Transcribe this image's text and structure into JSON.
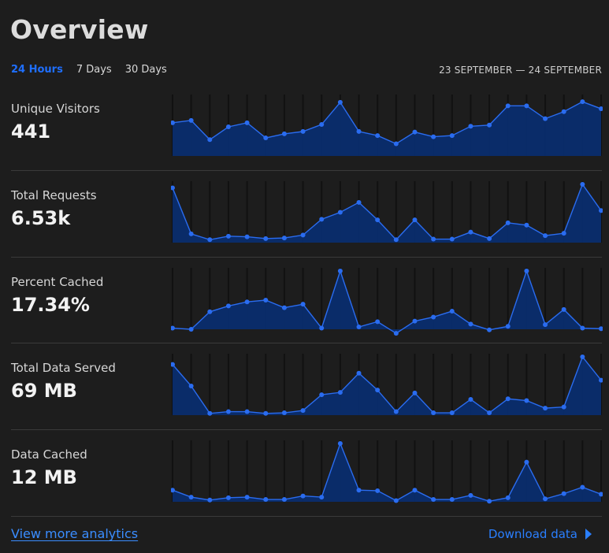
{
  "header": {
    "title": "Overview",
    "tabs": [
      {
        "label": "24 Hours",
        "active": true
      },
      {
        "label": "7 Days",
        "active": false
      },
      {
        "label": "30 Days",
        "active": false
      }
    ],
    "date_range": "23 SEPTEMBER — 24 SEPTEMBER"
  },
  "metrics": [
    {
      "label": "Unique Visitors",
      "value": "441"
    },
    {
      "label": "Total Requests",
      "value": "6.53k"
    },
    {
      "label": "Percent Cached",
      "value": "17.34%"
    },
    {
      "label": "Total Data Served",
      "value": "69 MB"
    },
    {
      "label": "Data Cached",
      "value": "12 MB"
    }
  ],
  "footer": {
    "more_label": "View more analytics",
    "download_label": "Download data"
  },
  "colors": {
    "fill": "#0a2d6e",
    "line": "#2a6cf0",
    "point": "#2a6cf0",
    "grid": "#111111",
    "accent": "#1f6fff"
  },
  "icons": {
    "download": "triangle-right-icon"
  },
  "chart_data": [
    {
      "type": "area",
      "series": [
        {
          "values": [
            57,
            61,
            28,
            50,
            57,
            31,
            38,
            42,
            54,
            92,
            42,
            35,
            21,
            41,
            33,
            35,
            51,
            53,
            86,
            86,
            64,
            76,
            93,
            81
          ]
        }
      ],
      "ylim": [
        0,
        100
      ],
      "grid": true
    },
    {
      "type": "area",
      "series": [
        {
          "values": [
            94,
            15,
            5,
            11,
            10,
            7,
            8,
            13,
            40,
            52,
            69,
            39,
            5,
            39,
            6,
            6,
            18,
            7,
            34,
            30,
            12,
            16,
            100,
            55
          ]
        }
      ],
      "ylim": [
        0,
        100
      ],
      "grid": true
    },
    {
      "type": "area",
      "series": [
        {
          "values": [
            2,
            0,
            30,
            40,
            47,
            50,
            37,
            43,
            2,
            100,
            4,
            13,
            -7,
            14,
            21,
            31,
            9,
            -1,
            5,
            100,
            8,
            34,
            2,
            1
          ]
        }
      ],
      "ylim": [
        0,
        100
      ],
      "grid": true
    },
    {
      "type": "area",
      "series": [
        {
          "values": [
            87,
            50,
            3,
            6,
            6,
            3,
            4,
            8,
            35,
            39,
            72,
            43,
            6,
            38,
            4,
            4,
            27,
            4,
            28,
            25,
            12,
            14,
            100,
            60
          ]
        }
      ],
      "ylim": [
        0,
        100
      ],
      "grid": true
    },
    {
      "type": "area",
      "series": [
        {
          "values": [
            20,
            8,
            3,
            7,
            8,
            4,
            4,
            10,
            8,
            100,
            20,
            19,
            2,
            20,
            4,
            4,
            11,
            1,
            7,
            68,
            5,
            14,
            25,
            13
          ]
        }
      ],
      "ylim": [
        0,
        100
      ],
      "grid": true
    }
  ]
}
